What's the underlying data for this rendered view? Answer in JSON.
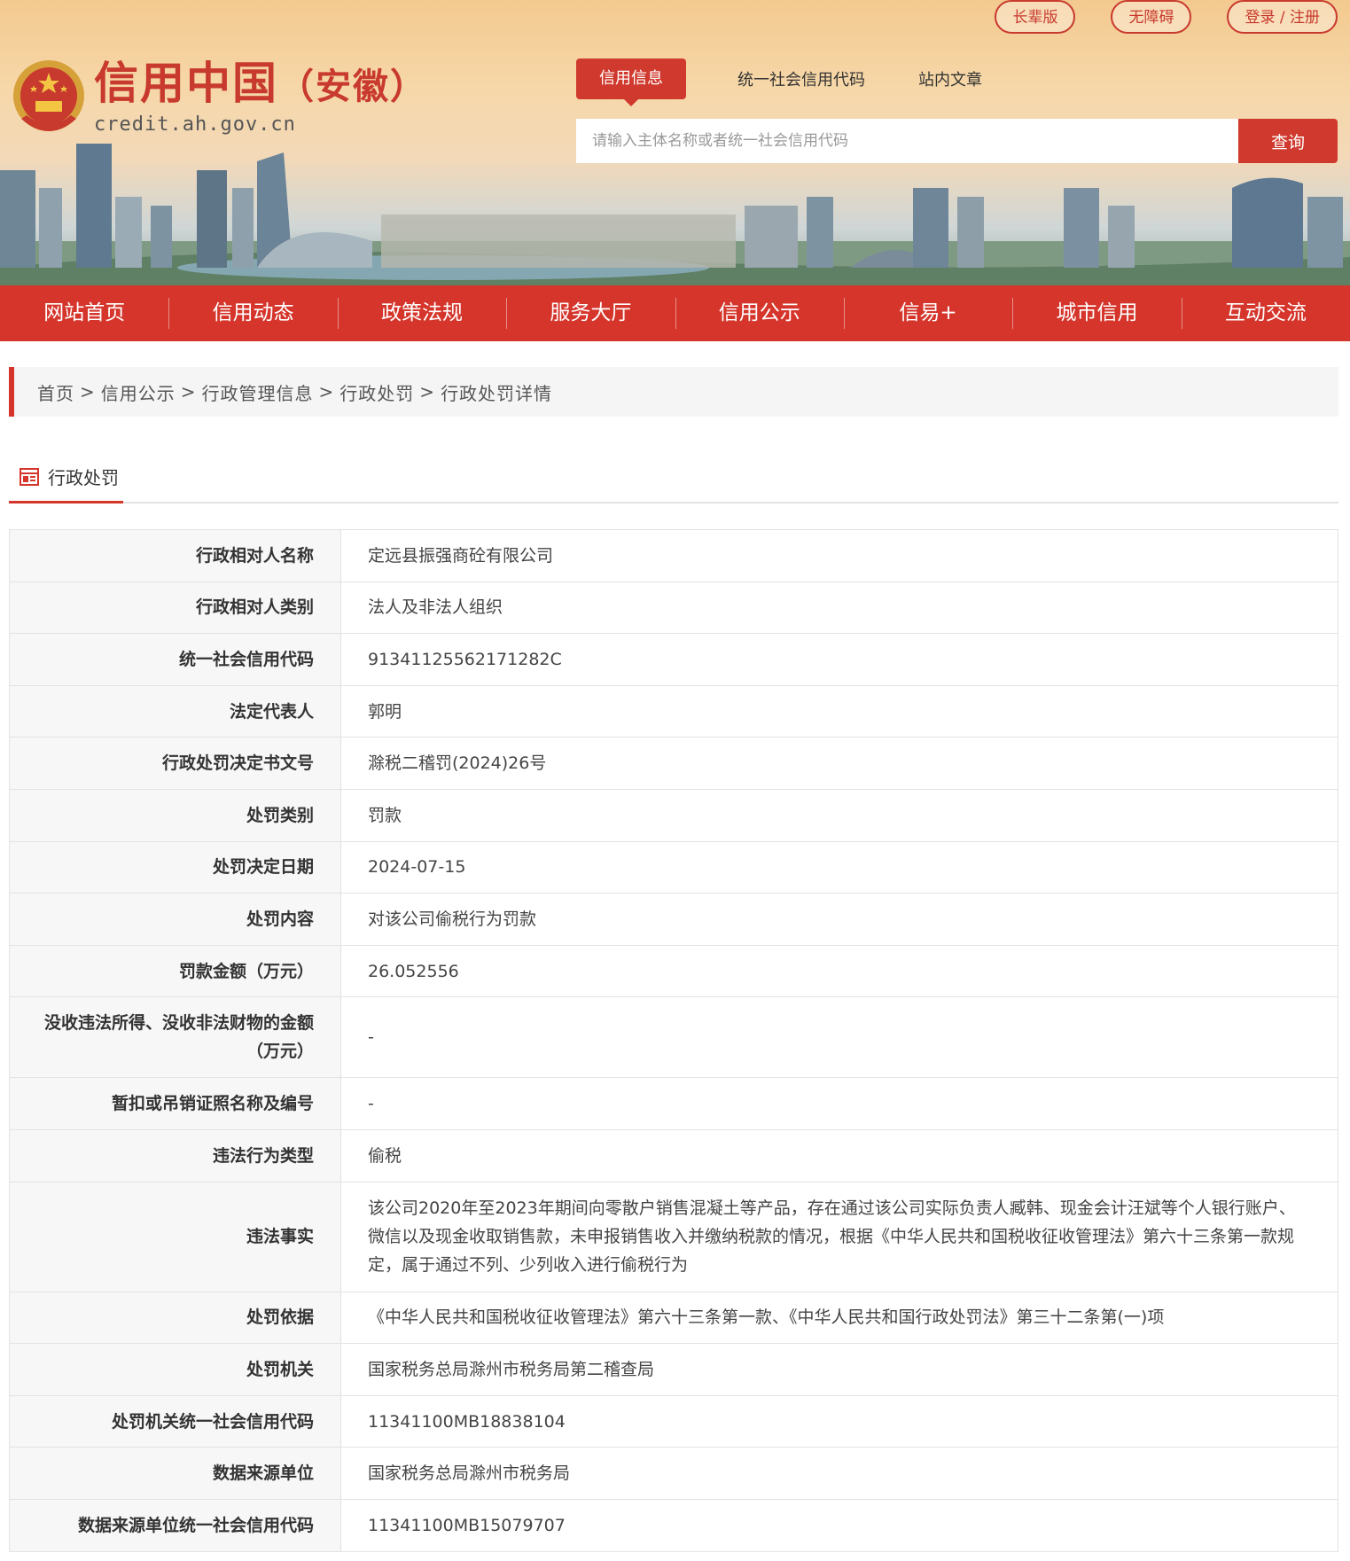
{
  "top_links": [
    "长辈版",
    "无障碍",
    "登录 / 注册"
  ],
  "logo": {
    "title": "信用中国",
    "province": "安徽",
    "url": "credit.ah.gov.cn"
  },
  "search": {
    "tabs": [
      "信用信息",
      "统一社会信用代码",
      "站内文章"
    ],
    "placeholder": "请输入主体名称或者统一社会信用代码",
    "button": "查询"
  },
  "nav": [
    "网站首页",
    "信用动态",
    "政策法规",
    "服务大厅",
    "信用公示",
    "信易+",
    "城市信用",
    "互动交流"
  ],
  "breadcrumb": [
    "首页",
    "信用公示",
    "行政管理信息",
    "行政处罚",
    "行政处罚详情"
  ],
  "section_title": "行政处罚",
  "rows": [
    {
      "label": "行政相对人名称",
      "value": "定远县振强商砼有限公司"
    },
    {
      "label": "行政相对人类别",
      "value": "法人及非法人组织"
    },
    {
      "label": "统一社会信用代码",
      "value": "91341125562171282C"
    },
    {
      "label": "法定代表人",
      "value": "郭明"
    },
    {
      "label": "行政处罚决定书文号",
      "value": "滁税二稽罚(2024)26号"
    },
    {
      "label": "处罚类别",
      "value": "罚款"
    },
    {
      "label": "处罚决定日期",
      "value": "2024-07-15"
    },
    {
      "label": "处罚内容",
      "value": "对该公司偷税行为罚款"
    },
    {
      "label": "罚款金额（万元）",
      "value": "26.052556"
    },
    {
      "label": "没收违法所得、没收非法财物的金额（万元）",
      "value": "-"
    },
    {
      "label": "暂扣或吊销证照名称及编号",
      "value": "-"
    },
    {
      "label": "违法行为类型",
      "value": "偷税"
    },
    {
      "label": "违法事实",
      "value": "该公司2020年至2023年期间向零散户销售混凝土等产品，存在通过该公司实际负责人臧韩、现金会计汪斌等个人银行账户、微信以及现金收取销售款，未申报销售收入并缴纳税款的情况，根据《中华人民共和国税收征收管理法》第六十三条第一款规定，属于通过不列、少列收入进行偷税行为"
    },
    {
      "label": "处罚依据",
      "value": "《中华人民共和国税收征收管理法》第六十三条第一款、《中华人民共和国行政处罚法》第三十二条第(一)项"
    },
    {
      "label": "处罚机关",
      "value": "国家税务总局滁州市税务局第二稽查局"
    },
    {
      "label": "处罚机关统一社会信用代码",
      "value": "11341100MB18838104"
    },
    {
      "label": "数据来源单位",
      "value": "国家税务总局滁州市税务局"
    },
    {
      "label": "数据来源单位统一社会信用代码",
      "value": "11341100MB15079707"
    }
  ],
  "colors": {
    "brand_red": "#d5352b",
    "label_bg": "#f7f7f7",
    "border": "#e3e3e3"
  }
}
